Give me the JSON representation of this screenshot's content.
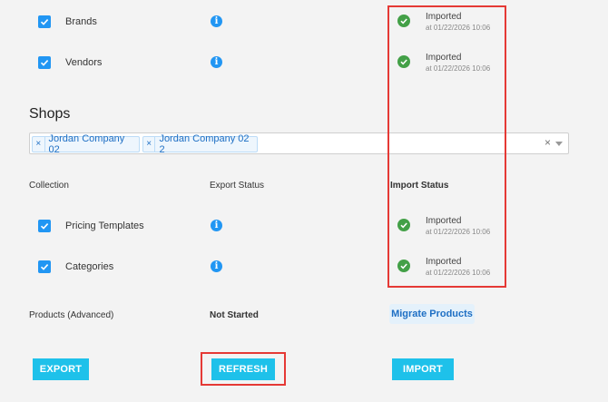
{
  "top_rows": [
    {
      "label": "Brands",
      "status": "Imported",
      "time": "at 01/22/2026 10:06"
    },
    {
      "label": "Vendors",
      "status": "Imported",
      "time": "at 01/22/2026 10:06"
    }
  ],
  "shops": {
    "title": "Shops",
    "chips": [
      "Jordan Company 02",
      "Jordan Company 02 2"
    ],
    "chip_remove": "×",
    "clear": "×"
  },
  "columns": {
    "collection": "Collection",
    "export_status": "Export Status",
    "import_status": "Import Status"
  },
  "collection_rows": [
    {
      "label": "Pricing Templates",
      "status": "Imported",
      "time": "at 01/22/2026 10:06"
    },
    {
      "label": "Categories",
      "status": "Imported",
      "time": "at 01/22/2026 10:06"
    }
  ],
  "products": {
    "label": "Products (Advanced)",
    "export_status": "Not Started",
    "action": "Migrate Products"
  },
  "buttons": {
    "export": "EXPORT",
    "refresh": "REFRESH",
    "import": "IMPORT"
  },
  "info_glyph": "i",
  "colors": {
    "accent": "#2196f3",
    "button": "#1ec1ea",
    "success": "#43a047",
    "highlight": "#e53935"
  }
}
